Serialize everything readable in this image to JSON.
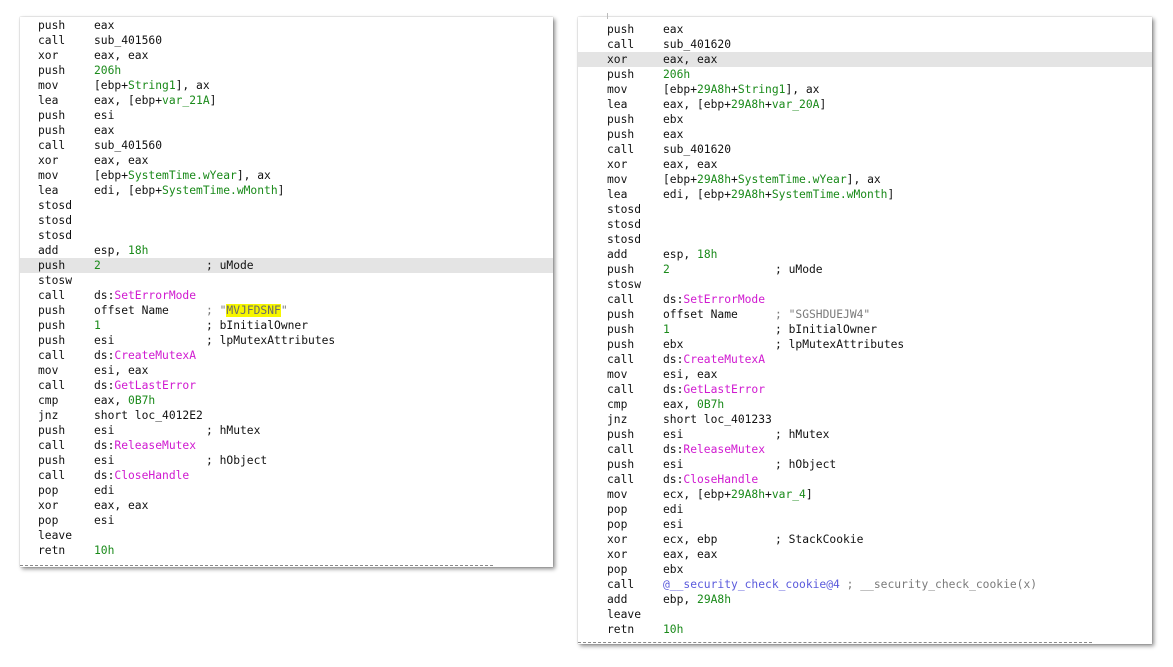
{
  "colors": {
    "background": "#ffffff",
    "highlight_row": "#e4e4e4",
    "text": "#111111",
    "number_green": "#1a8a1a",
    "api_magenta": "#d01ad0",
    "string_gray": "#7a7a7a",
    "string_highlight_yellow": "#f6f600",
    "function_blue": "#5a5adc"
  },
  "left_panel": {
    "lines": [
      {
        "mn": "push",
        "op": [
          {
            "t": "eax"
          }
        ]
      },
      {
        "mn": "call",
        "op": [
          {
            "t": "sub_401560"
          }
        ]
      },
      {
        "mn": "xor",
        "op": [
          {
            "t": "eax, eax"
          }
        ]
      },
      {
        "mn": "push",
        "op": [
          {
            "t": "206h",
            "c": "num"
          }
        ]
      },
      {
        "mn": "mov",
        "op": [
          {
            "t": "[ebp+"
          },
          {
            "t": "String1",
            "c": "sym"
          },
          {
            "t": "], ax"
          }
        ]
      },
      {
        "mn": "lea",
        "op": [
          {
            "t": "eax, [ebp+"
          },
          {
            "t": "var_21A",
            "c": "sym"
          },
          {
            "t": "]"
          }
        ]
      },
      {
        "mn": "push",
        "op": [
          {
            "t": "esi"
          }
        ]
      },
      {
        "mn": "push",
        "op": [
          {
            "t": "eax"
          }
        ]
      },
      {
        "mn": "call",
        "op": [
          {
            "t": "sub_401560"
          }
        ]
      },
      {
        "mn": "xor",
        "op": [
          {
            "t": "eax, eax"
          }
        ]
      },
      {
        "mn": "mov",
        "op": [
          {
            "t": "[ebp+"
          },
          {
            "t": "SystemTime.wYear",
            "c": "sym"
          },
          {
            "t": "], ax"
          }
        ]
      },
      {
        "mn": "lea",
        "op": [
          {
            "t": "edi, [ebp+"
          },
          {
            "t": "SystemTime.wMonth",
            "c": "sym"
          },
          {
            "t": "]"
          }
        ]
      },
      {
        "mn": "stosd",
        "op": []
      },
      {
        "mn": "stosd",
        "op": []
      },
      {
        "mn": "stosd",
        "op": []
      },
      {
        "mn": "add",
        "op": [
          {
            "t": "esp, "
          },
          {
            "t": "18h",
            "c": "num"
          }
        ]
      },
      {
        "mn": "push",
        "op": [
          {
            "t": "2",
            "c": "num"
          }
        ],
        "cm": [
          {
            "t": "; uMode"
          }
        ],
        "hl": true
      },
      {
        "mn": "stosw",
        "op": []
      },
      {
        "mn": "call",
        "op": [
          {
            "t": "ds:"
          },
          {
            "t": "SetErrorMode",
            "c": "api"
          }
        ]
      },
      {
        "mn": "push",
        "op": [
          {
            "t": "offset Name"
          }
        ],
        "cm": [
          {
            "t": "; ",
            "c": "str"
          },
          {
            "t": "\"",
            "c": "str"
          },
          {
            "t": "MVJFDSNF",
            "c": "strhl"
          },
          {
            "t": "\"",
            "c": "str"
          }
        ]
      },
      {
        "mn": "push",
        "op": [
          {
            "t": "1",
            "c": "num"
          }
        ],
        "cm": [
          {
            "t": "; bInitialOwner"
          }
        ]
      },
      {
        "mn": "push",
        "op": [
          {
            "t": "esi"
          }
        ],
        "cm": [
          {
            "t": "; lpMutexAttributes"
          }
        ]
      },
      {
        "mn": "call",
        "op": [
          {
            "t": "ds:"
          },
          {
            "t": "CreateMutexA",
            "c": "api"
          }
        ]
      },
      {
        "mn": "mov",
        "op": [
          {
            "t": "esi, eax"
          }
        ]
      },
      {
        "mn": "call",
        "op": [
          {
            "t": "ds:"
          },
          {
            "t": "GetLastError",
            "c": "api"
          }
        ]
      },
      {
        "mn": "cmp",
        "op": [
          {
            "t": "eax, "
          },
          {
            "t": "0B7h",
            "c": "num"
          }
        ]
      },
      {
        "mn": "jnz",
        "op": [
          {
            "t": "short loc_4012E2"
          }
        ]
      },
      {
        "mn": "push",
        "op": [
          {
            "t": "esi"
          }
        ],
        "cm": [
          {
            "t": "; hMutex"
          }
        ]
      },
      {
        "mn": "call",
        "op": [
          {
            "t": "ds:"
          },
          {
            "t": "ReleaseMutex",
            "c": "api"
          }
        ]
      },
      {
        "mn": "push",
        "op": [
          {
            "t": "esi"
          }
        ],
        "cm": [
          {
            "t": "; hObject"
          }
        ]
      },
      {
        "mn": "call",
        "op": [
          {
            "t": "ds:"
          },
          {
            "t": "CloseHandle",
            "c": "api"
          }
        ]
      },
      {
        "mn": "pop",
        "op": [
          {
            "t": "edi"
          }
        ]
      },
      {
        "mn": "xor",
        "op": [
          {
            "t": "eax, eax"
          }
        ]
      },
      {
        "mn": "pop",
        "op": [
          {
            "t": "esi"
          }
        ]
      },
      {
        "mn": "leave",
        "op": []
      },
      {
        "mn": "retn",
        "op": [
          {
            "t": "10h",
            "c": "num"
          }
        ]
      }
    ]
  },
  "right_panel": {
    "lines": [
      {
        "mn": "push",
        "op": [
          {
            "t": "eax"
          }
        ]
      },
      {
        "mn": "call",
        "op": [
          {
            "t": "sub_401620"
          }
        ]
      },
      {
        "mn": "xor",
        "op": [
          {
            "t": "eax, eax"
          }
        ],
        "hl": true
      },
      {
        "mn": "push",
        "op": [
          {
            "t": "206h",
            "c": "num"
          }
        ]
      },
      {
        "mn": "mov",
        "op": [
          {
            "t": "[ebp+"
          },
          {
            "t": "29A8h",
            "c": "num"
          },
          {
            "t": "+"
          },
          {
            "t": "String1",
            "c": "sym"
          },
          {
            "t": "], ax"
          }
        ]
      },
      {
        "mn": "lea",
        "op": [
          {
            "t": "eax, [ebp+"
          },
          {
            "t": "29A8h",
            "c": "num"
          },
          {
            "t": "+"
          },
          {
            "t": "var_20A",
            "c": "sym"
          },
          {
            "t": "]"
          }
        ]
      },
      {
        "mn": "push",
        "op": [
          {
            "t": "ebx"
          }
        ]
      },
      {
        "mn": "push",
        "op": [
          {
            "t": "eax"
          }
        ]
      },
      {
        "mn": "call",
        "op": [
          {
            "t": "sub_401620"
          }
        ]
      },
      {
        "mn": "xor",
        "op": [
          {
            "t": "eax, eax"
          }
        ]
      },
      {
        "mn": "mov",
        "op": [
          {
            "t": "[ebp+"
          },
          {
            "t": "29A8h",
            "c": "num"
          },
          {
            "t": "+"
          },
          {
            "t": "SystemTime.wYear",
            "c": "sym"
          },
          {
            "t": "], ax"
          }
        ]
      },
      {
        "mn": "lea",
        "op": [
          {
            "t": "edi, [ebp+"
          },
          {
            "t": "29A8h",
            "c": "num"
          },
          {
            "t": "+"
          },
          {
            "t": "SystemTime.wMonth",
            "c": "sym"
          },
          {
            "t": "]"
          }
        ]
      },
      {
        "mn": "stosd",
        "op": []
      },
      {
        "mn": "stosd",
        "op": []
      },
      {
        "mn": "stosd",
        "op": []
      },
      {
        "mn": "add",
        "op": [
          {
            "t": "esp, "
          },
          {
            "t": "18h",
            "c": "num"
          }
        ]
      },
      {
        "mn": "push",
        "op": [
          {
            "t": "2",
            "c": "num"
          }
        ],
        "cm": [
          {
            "t": "; uMode"
          }
        ]
      },
      {
        "mn": "stosw",
        "op": []
      },
      {
        "mn": "call",
        "op": [
          {
            "t": "ds:"
          },
          {
            "t": "SetErrorMode",
            "c": "api"
          }
        ]
      },
      {
        "mn": "push",
        "op": [
          {
            "t": "offset Name"
          }
        ],
        "cm": [
          {
            "t": "; \"SGSHDUEJW4\"",
            "c": "str"
          }
        ]
      },
      {
        "mn": "push",
        "op": [
          {
            "t": "1",
            "c": "num"
          }
        ],
        "cm": [
          {
            "t": "; bInitialOwner"
          }
        ]
      },
      {
        "mn": "push",
        "op": [
          {
            "t": "ebx"
          }
        ],
        "cm": [
          {
            "t": "; lpMutexAttributes"
          }
        ]
      },
      {
        "mn": "call",
        "op": [
          {
            "t": "ds:"
          },
          {
            "t": "CreateMutexA",
            "c": "api"
          }
        ]
      },
      {
        "mn": "mov",
        "op": [
          {
            "t": "esi, eax"
          }
        ]
      },
      {
        "mn": "call",
        "op": [
          {
            "t": "ds:"
          },
          {
            "t": "GetLastError",
            "c": "api"
          }
        ]
      },
      {
        "mn": "cmp",
        "op": [
          {
            "t": "eax, "
          },
          {
            "t": "0B7h",
            "c": "num"
          }
        ]
      },
      {
        "mn": "jnz",
        "op": [
          {
            "t": "short loc_401233"
          }
        ]
      },
      {
        "mn": "push",
        "op": [
          {
            "t": "esi"
          }
        ],
        "cm": [
          {
            "t": "; hMutex"
          }
        ]
      },
      {
        "mn": "call",
        "op": [
          {
            "t": "ds:"
          },
          {
            "t": "ReleaseMutex",
            "c": "api"
          }
        ]
      },
      {
        "mn": "push",
        "op": [
          {
            "t": "esi"
          }
        ],
        "cm": [
          {
            "t": "; hObject"
          }
        ]
      },
      {
        "mn": "call",
        "op": [
          {
            "t": "ds:"
          },
          {
            "t": "CloseHandle",
            "c": "api"
          }
        ]
      },
      {
        "mn": "mov",
        "op": [
          {
            "t": "ecx, [ebp+"
          },
          {
            "t": "29A8h",
            "c": "num"
          },
          {
            "t": "+"
          },
          {
            "t": "var_4",
            "c": "sym"
          },
          {
            "t": "]"
          }
        ]
      },
      {
        "mn": "pop",
        "op": [
          {
            "t": "edi"
          }
        ]
      },
      {
        "mn": "pop",
        "op": [
          {
            "t": "esi"
          }
        ]
      },
      {
        "mn": "xor",
        "op": [
          {
            "t": "ecx, ebp"
          }
        ],
        "cm": [
          {
            "t": "; StackCookie"
          }
        ]
      },
      {
        "mn": "xor",
        "op": [
          {
            "t": "eax, eax"
          }
        ]
      },
      {
        "mn": "pop",
        "op": [
          {
            "t": "ebx"
          }
        ]
      },
      {
        "mn": "call",
        "op": [
          {
            "t": "@__security_check_cookie@4",
            "c": "fn"
          },
          {
            "t": " ; __security_check_cookie(x)",
            "c": "cmg"
          }
        ]
      },
      {
        "mn": "add",
        "op": [
          {
            "t": "ebp, "
          },
          {
            "t": "29A8h",
            "c": "num"
          }
        ]
      },
      {
        "mn": "leave",
        "op": []
      },
      {
        "mn": "retn",
        "op": [
          {
            "t": "10h",
            "c": "num"
          }
        ]
      }
    ]
  }
}
